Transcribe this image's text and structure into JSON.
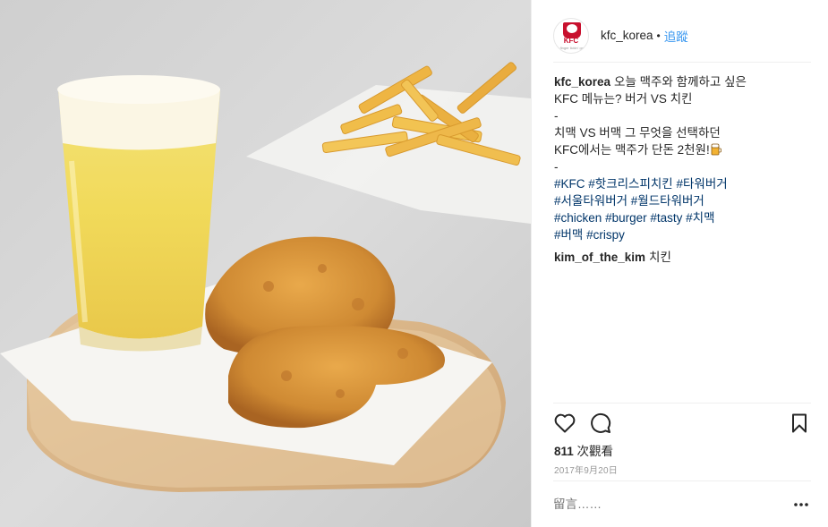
{
  "header": {
    "username": "kfc_korea",
    "separator": "•",
    "follow_label": "追蹤",
    "avatar_logo_text": "KFC",
    "avatar_logo_subtext": "It's finger lickin' good"
  },
  "caption": {
    "username": "kfc_korea",
    "line1_text": "오늘 맥주와 함께하고 싶은",
    "line2": "KFC 메뉴는? 버거 VS 치킨",
    "line3": "-",
    "line4": "치맥 VS 버맥 그 무엇을 선택하던",
    "line5": "KFC에서는 맥주가 단돈 2천원!",
    "line5_emoji": "beer-mug-icon",
    "line6": "-",
    "hashtag_lines": [
      [
        "#KFC",
        "#핫크리스피치킨",
        "#타워버거"
      ],
      [
        "#서울타워버거",
        "#월드타워버거"
      ],
      [
        "#chicken",
        "#burger",
        "#tasty",
        "#치맥"
      ],
      [
        "#버맥",
        "#crispy"
      ]
    ]
  },
  "comment": {
    "username": "kim_of_the_kim",
    "text": "치킨"
  },
  "actions": {
    "like_icon": "heart-icon",
    "comment_icon": "comment-icon",
    "save_icon": "bookmark-icon"
  },
  "stats": {
    "views_count": "811",
    "views_label": "次觀看",
    "date": "2017年9月20日"
  },
  "add_comment": {
    "placeholder": "留言……",
    "more_icon": "more-options-icon"
  },
  "colors": {
    "link_blue": "#3897f0",
    "hashtag": "#003569",
    "text": "#262626",
    "muted": "#999999",
    "divider": "#efefef",
    "kfc_red": "#c8102e"
  }
}
